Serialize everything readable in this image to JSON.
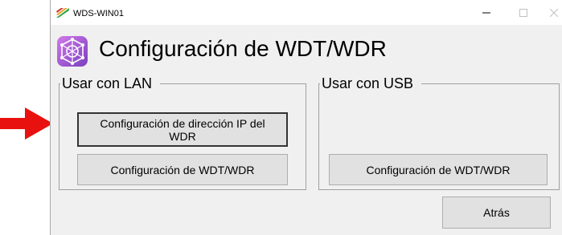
{
  "window": {
    "title": "WDS-WIN01"
  },
  "header": {
    "title": "Configuración de WDT/WDR",
    "icon": "network-globe-icon"
  },
  "lan_group": {
    "label": "Usar con LAN",
    "ip_button": "Configuración de dirección IP del WDR",
    "wdt_button": "Configuración de WDT/WDR"
  },
  "usb_group": {
    "label": "Usar con USB",
    "wdt_button": "Configuración de WDT/WDR"
  },
  "footer": {
    "back_button": "Atrás"
  },
  "colors": {
    "arrow": "#e8110f",
    "header_icon": "#9b4fd6",
    "window_bg": "#f0f0f0",
    "button_bg": "#e1e1e1"
  }
}
